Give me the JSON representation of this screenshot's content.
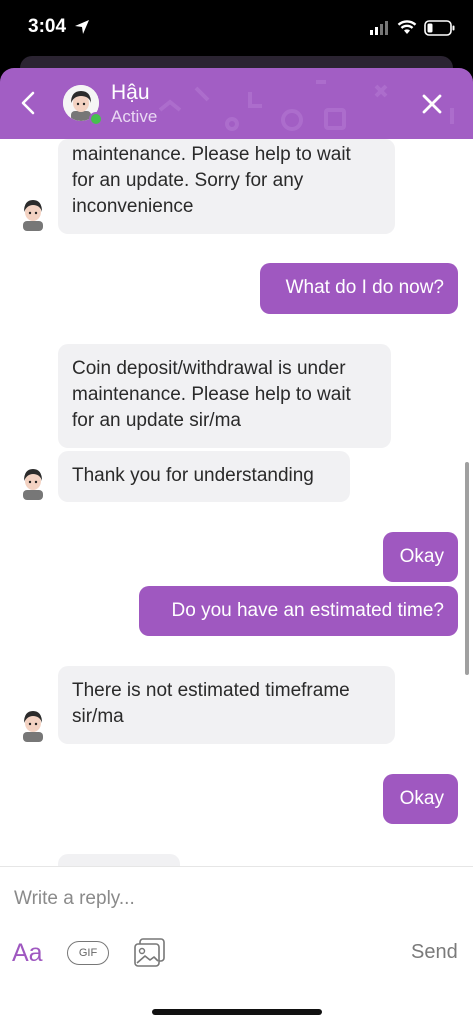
{
  "status_bar": {
    "time": "3:04"
  },
  "header": {
    "name": "Hậu",
    "status": "Active"
  },
  "messages": [
    {
      "dir": "in",
      "text": "maintenance. Please help to wait\nfor an update. Sorry for any\ninconvenience"
    },
    {
      "dir": "out",
      "text": "What do I do now?"
    },
    {
      "dir": "in",
      "text": "Coin deposit/withdrawal is under\nmaintenance. Please help to wait\nfor an update sir/ma"
    },
    {
      "dir": "in",
      "text": "Thank you for understanding"
    },
    {
      "dir": "out",
      "text": "Okay"
    },
    {
      "dir": "out",
      "text": "Do you have an estimated time?"
    },
    {
      "dir": "in",
      "text": "There is not estimated timeframe\nsir/ma"
    },
    {
      "dir": "out",
      "text": "Okay"
    }
  ],
  "composer": {
    "placeholder": "Write a reply...",
    "aa_label": "Aa",
    "gif_label": "GIF",
    "send_label": "Send",
    "image_icon": "image-icon"
  },
  "colors": {
    "accent": "#a25ec4",
    "bubble_out": "#9f58c0",
    "bubble_in": "#f1f1f3",
    "online": "#46c04e"
  }
}
